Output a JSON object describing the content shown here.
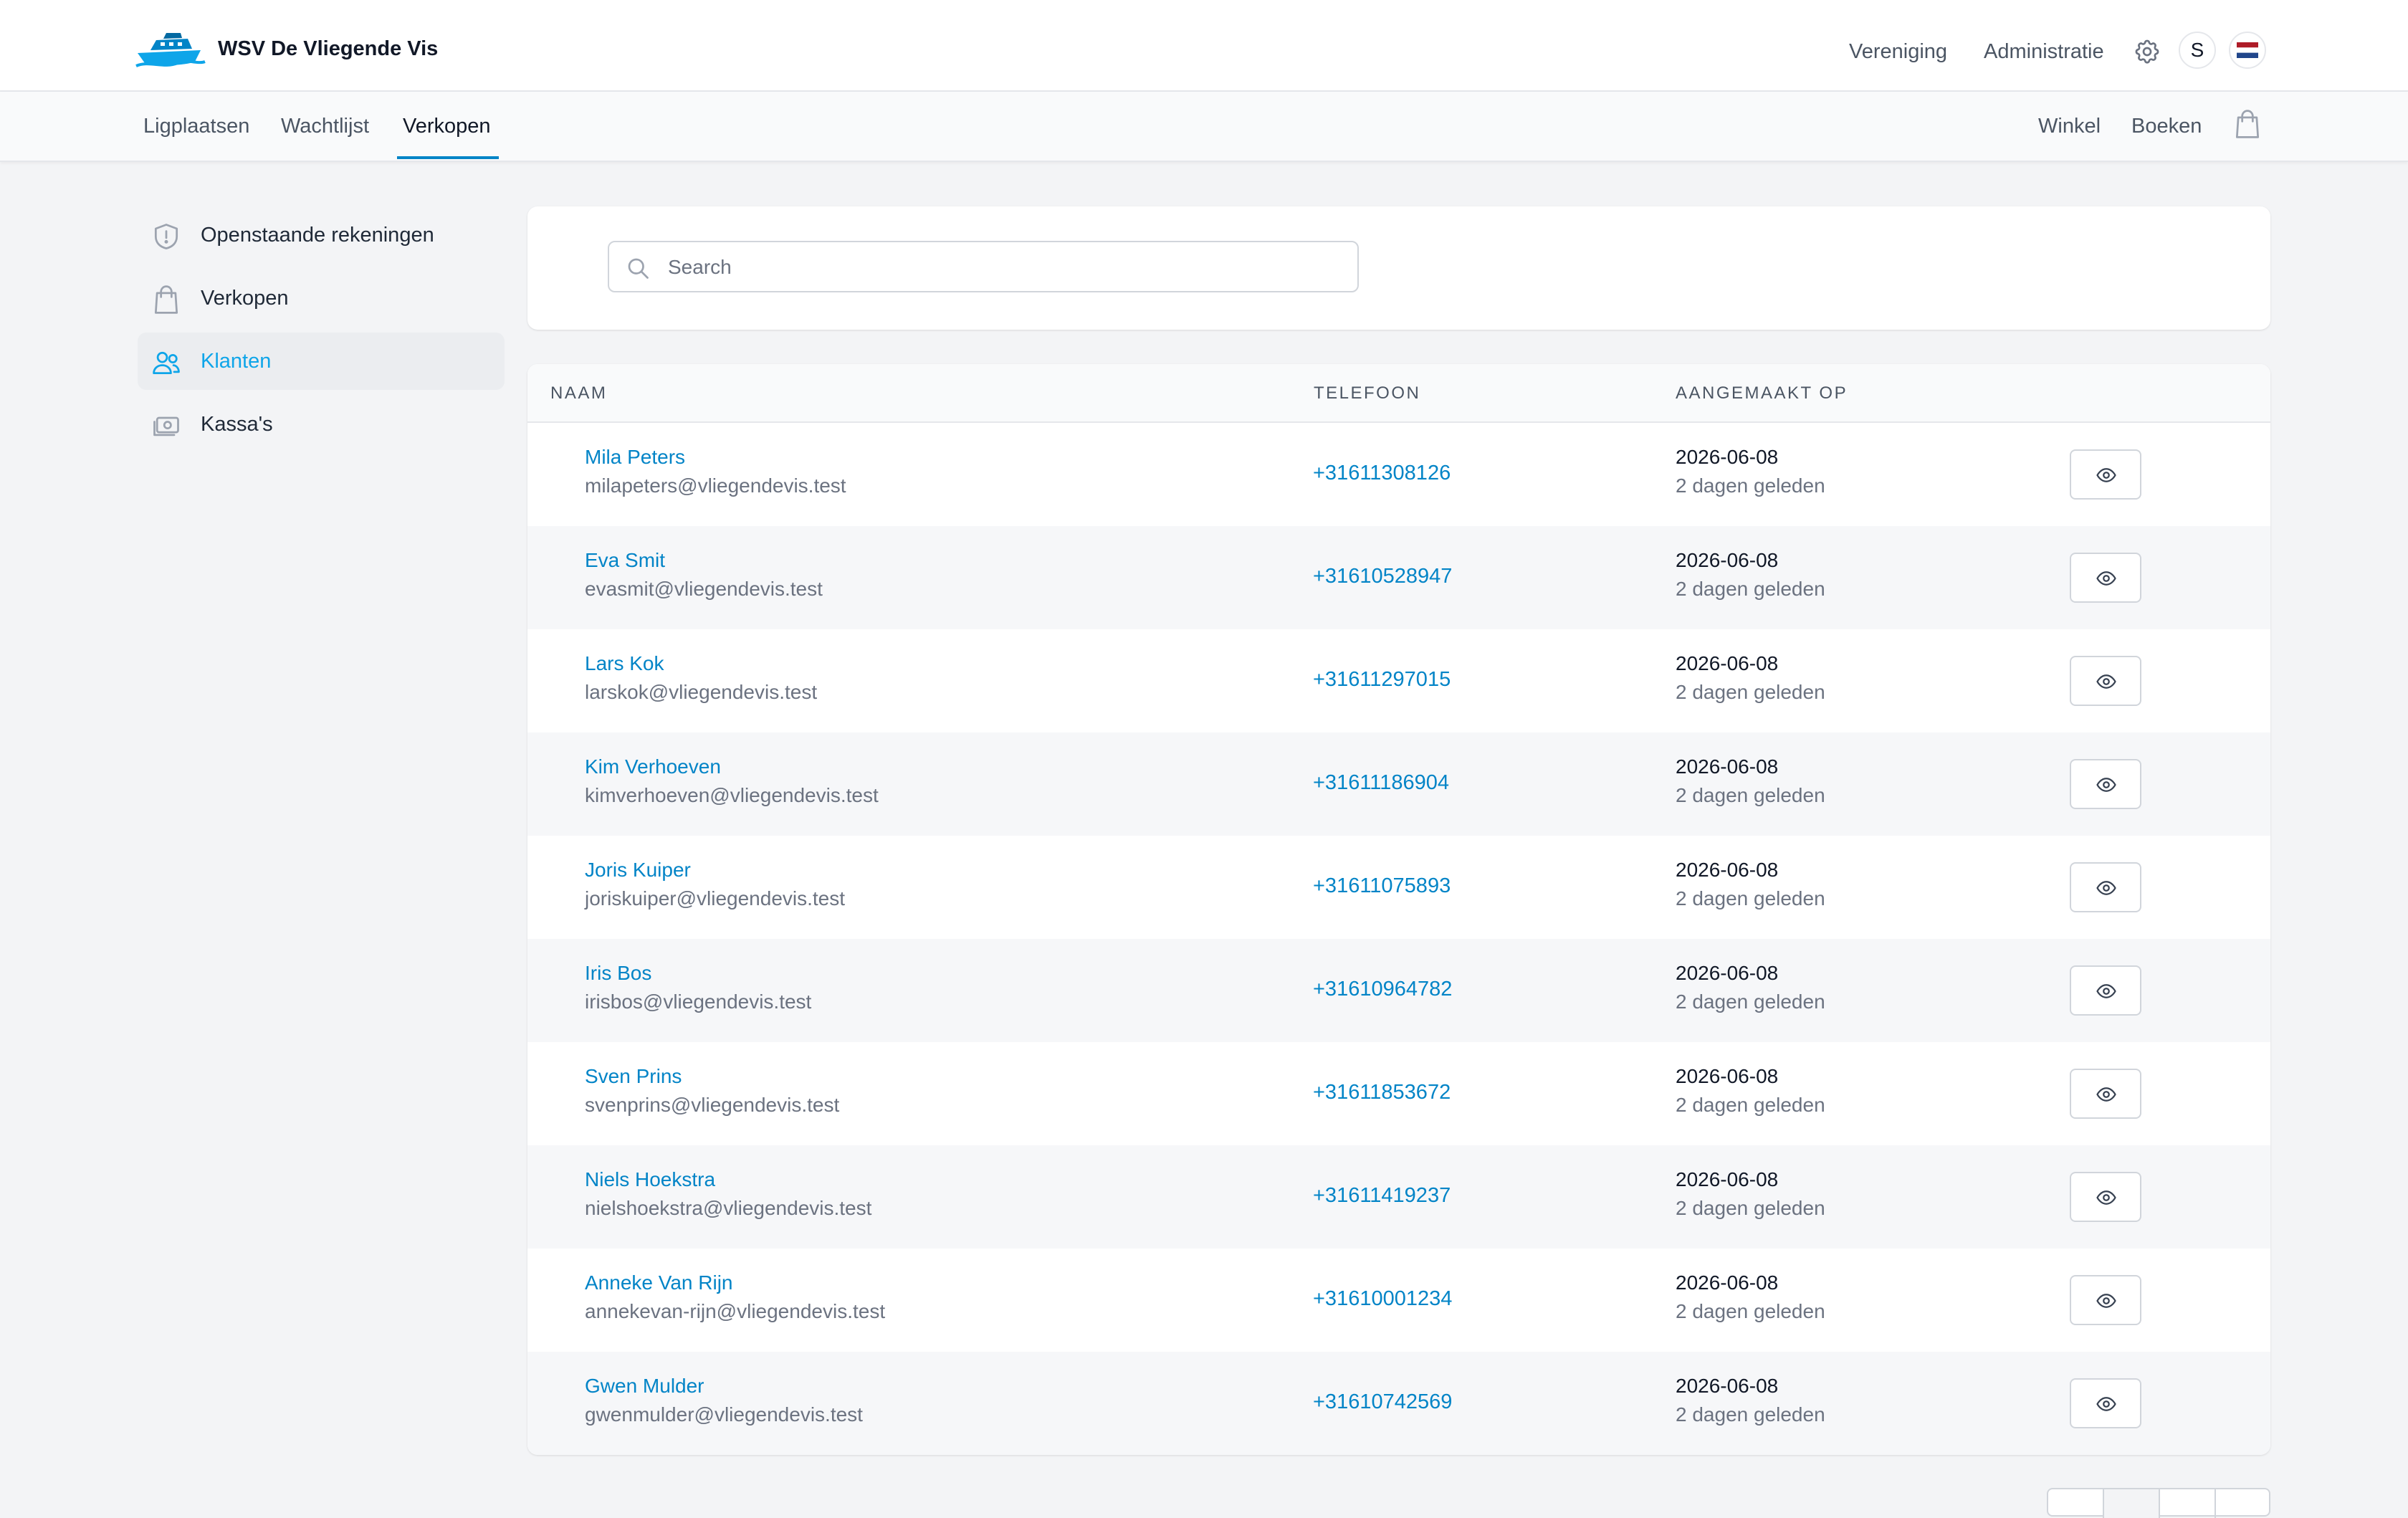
{
  "header": {
    "brand": "WSV De Vliegende Vis",
    "nav": [
      "Vereniging",
      "Administratie"
    ],
    "avatar_initial": "S"
  },
  "subnav": {
    "tabs": [
      "Ligplaatsen",
      "Wachtlijst",
      "Verkopen"
    ],
    "active_tab": "Verkopen",
    "right": [
      "Winkel",
      "Boeken"
    ]
  },
  "sidebar": {
    "items": [
      {
        "label": "Openstaande rekeningen",
        "icon": "shield-exclamation-icon"
      },
      {
        "label": "Verkopen",
        "icon": "shopping-bag-icon"
      },
      {
        "label": "Klanten",
        "icon": "users-icon"
      },
      {
        "label": "Kassa's",
        "icon": "cash-icon"
      }
    ],
    "active_item": "Klanten"
  },
  "search": {
    "placeholder": "Search",
    "value": ""
  },
  "table": {
    "columns": [
      "NAAM",
      "TELEFOON",
      "AANGEMAAKT OP"
    ],
    "rows": [
      {
        "name": "Mila Peters",
        "email": "milapeters@vliegendevis.test",
        "phone": "+31611308126",
        "date": "2026-06-08",
        "ago": "2 dagen geleden"
      },
      {
        "name": "Eva Smit",
        "email": "evasmit@vliegendevis.test",
        "phone": "+31610528947",
        "date": "2026-06-08",
        "ago": "2 dagen geleden"
      },
      {
        "name": "Lars Kok",
        "email": "larskok@vliegendevis.test",
        "phone": "+31611297015",
        "date": "2026-06-08",
        "ago": "2 dagen geleden"
      },
      {
        "name": "Kim Verhoeven",
        "email": "kimverhoeven@vliegendevis.test",
        "phone": "+31611186904",
        "date": "2026-06-08",
        "ago": "2 dagen geleden"
      },
      {
        "name": "Joris Kuiper",
        "email": "joriskuiper@vliegendevis.test",
        "phone": "+31611075893",
        "date": "2026-06-08",
        "ago": "2 dagen geleden"
      },
      {
        "name": "Iris Bos",
        "email": "irisbos@vliegendevis.test",
        "phone": "+31610964782",
        "date": "2026-06-08",
        "ago": "2 dagen geleden"
      },
      {
        "name": "Sven Prins",
        "email": "svenprins@vliegendevis.test",
        "phone": "+31611853672",
        "date": "2026-06-08",
        "ago": "2 dagen geleden"
      },
      {
        "name": "Niels Hoekstra",
        "email": "nielshoekstra@vliegendevis.test",
        "phone": "+31611419237",
        "date": "2026-06-08",
        "ago": "2 dagen geleden"
      },
      {
        "name": "Anneke Van Rijn",
        "email": "annekevan-rijn@vliegendevis.test",
        "phone": "+31610001234",
        "date": "2026-06-08",
        "ago": "2 dagen geleden"
      },
      {
        "name": "Gwen Mulder",
        "email": "gwenmulder@vliegendevis.test",
        "phone": "+31610742569",
        "date": "2026-06-08",
        "ago": "2 dagen geleden"
      }
    ]
  },
  "colors": {
    "accent": "#0284c7",
    "active_sidebar": "#0ea5e9",
    "page_bg": "#f3f4f6"
  }
}
